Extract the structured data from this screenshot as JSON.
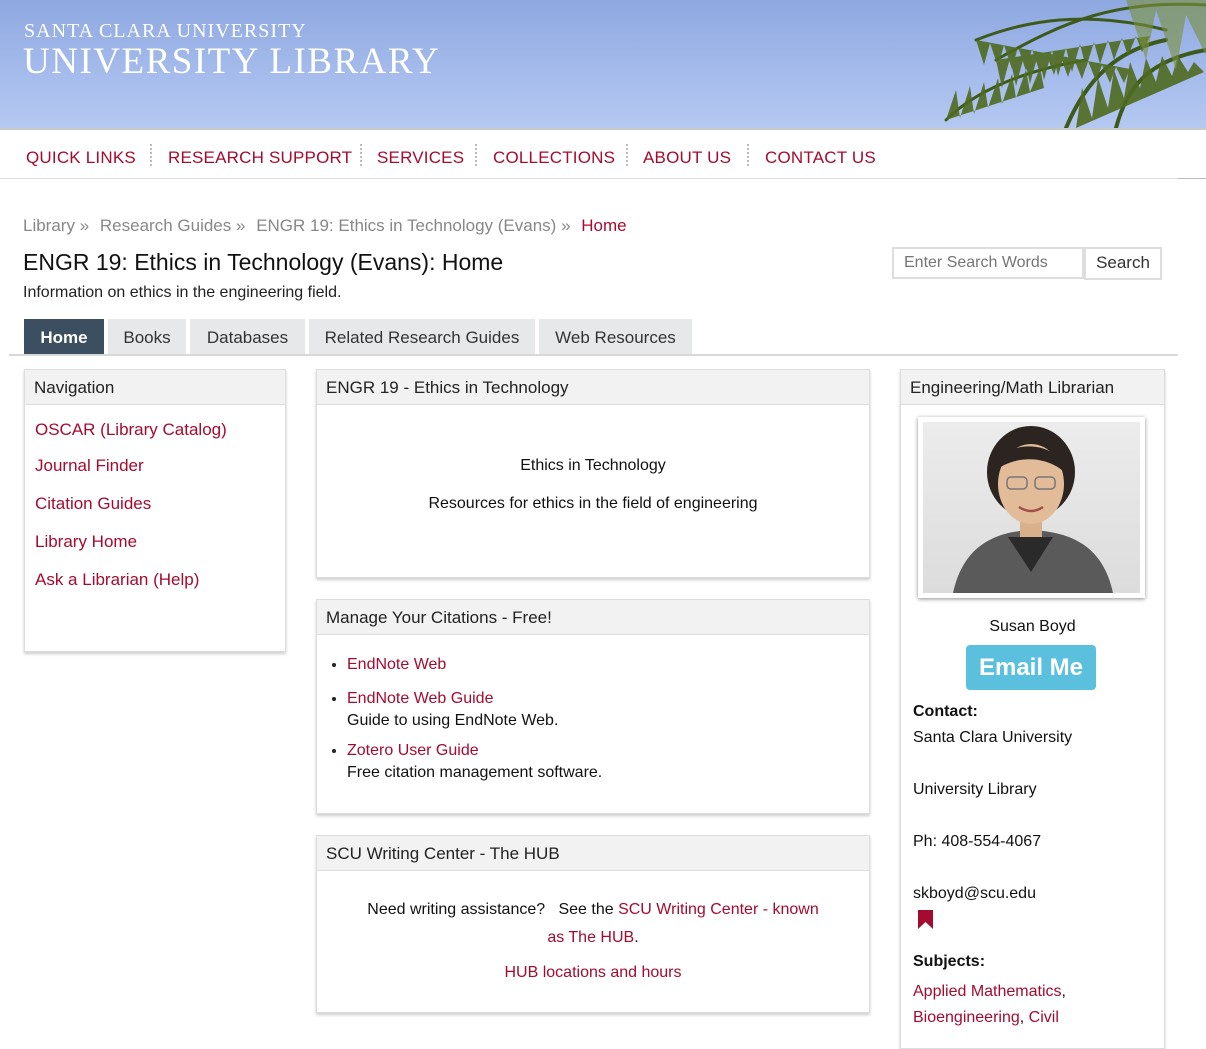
{
  "header": {
    "university": "SANTA CLARA UNIVERSITY",
    "library": "UNIVERSITY LIBRARY"
  },
  "mainnav": [
    "QUICK LINKS",
    "RESEARCH SUPPORT",
    "SERVICES",
    "COLLECTIONS",
    "ABOUT US",
    "CONTACT US"
  ],
  "breadcrumb": [
    "Library",
    "»",
    "Research Guides",
    "»",
    "ENGR 19: Ethics in Technology (Evans)",
    "»",
    "Home"
  ],
  "page": {
    "title": "ENGR 19: Ethics in Technology (Evans): Home",
    "description": "Information on ethics in the engineering field."
  },
  "search": {
    "placeholder": "Enter Search Words",
    "button": "Search"
  },
  "tabs": [
    "Home",
    "Books",
    "Databases",
    "Related Research Guides",
    "Web Resources"
  ],
  "navigation": {
    "title": "Navigation",
    "links": [
      "OSCAR (Library Catalog)",
      "Journal Finder",
      "Citation Guides",
      "Library Home",
      "Ask a Librarian (Help)"
    ]
  },
  "ethics_box": {
    "title": "ENGR 19 - Ethics in Technology",
    "line1": "Ethics in Technology",
    "line2": "Resources for ethics in the field of engineering"
  },
  "citations_box": {
    "title": "Manage Your Citations - Free!",
    "items": [
      {
        "link": "EndNote Web",
        "desc": ""
      },
      {
        "link": "EndNote Web Guide",
        "desc": "Guide to using EndNote Web."
      },
      {
        "link": "Zotero User Guide",
        "desc": "Free citation management software."
      }
    ]
  },
  "hub_box": {
    "title": "SCU Writing Center - The HUB",
    "text": "Need writing assistance?   See the ",
    "link_part1": "SCU Writing Center - known",
    "link_part2": "as The HUB",
    "period": ".",
    "hours_link": "HUB locations and hours"
  },
  "librarian": {
    "title": "Engineering/Math Librarian",
    "name": "Susan Boyd",
    "email_button": "Email Me",
    "contact_label": "Contact:",
    "contact_lines": [
      "Santa Clara University",
      "University Library",
      "Ph: 408-554-4067",
      "skboyd@scu.edu"
    ],
    "subjects_label": "Subjects:",
    "subjects": [
      "Applied Mathematics",
      ",",
      "Bioengineering",
      ",",
      "Civil"
    ]
  },
  "colors": {
    "accent": "#a50b2e",
    "active_tab": "#3b4f60",
    "email_button": "#5bc0de"
  }
}
